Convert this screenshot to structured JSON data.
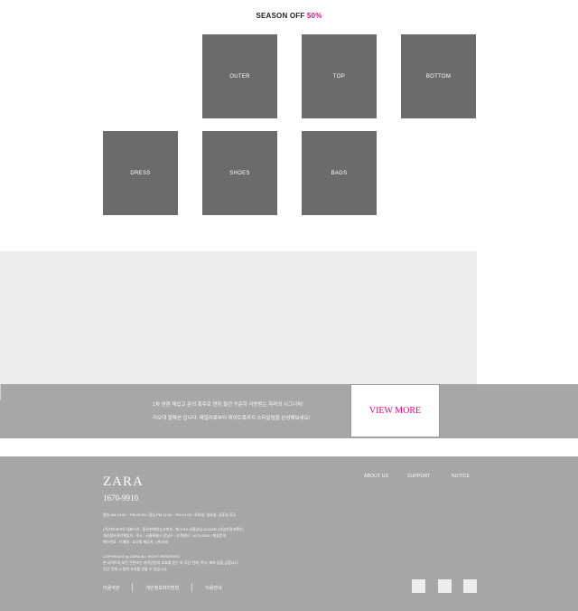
{
  "promo": {
    "title": "SEASON OFF",
    "percent": "50%"
  },
  "categories": [
    "OUTER",
    "TOP",
    "BOTTOM",
    "DRESS",
    "SHOES",
    "BAGS"
  ],
  "banner": {
    "line1": "1차 완판 재입고 문의 폭주로 연장,필간 꾸준히 사랑받는 자라의 시그니처!",
    "line2": "리오대 컬렉션 입니다. 데일리룩부터 데이트룩까지 스타일링을 완성해보세요!",
    "button": "VIEW MORE"
  },
  "footer": {
    "brand": "ZARA",
    "phone": "1670-9910",
    "hours": "평일 AM 10:00 ~ PM 05:00 / 점심 PM 12:00 ~ PM 01:00 / 토요일, 일요일, 공휴일 휴무",
    "info1": "(주)자라코리아 대표이사 : 통신판매업신고번호 : 제 2010-서울강남-01234호 (사업자정보확인)",
    "info2": "개인정보관리책임자 : 주소 : 서울특별시 강남구 / 고객센터 : 1670-9910 / 제휴문의",
    "info3": "팩스번호 : 이메일 : 호스팅 제공자 : (주)자라",
    "copyright": "COPYRIGHT by ZARA ALL RIGHT RESERVED",
    "notice1": "본 사이트의 모든 콘텐츠는 저작권법의 보호를 받는 바 무단 전재, 복사, 배포 등을 금합니다.",
    "notice2": "무단 전재 시 법적 조치를 받을 수 있습니다.",
    "nav": [
      "ABOUT US",
      "SUPPORT",
      "NOTICE"
    ],
    "links": [
      "이용약관",
      "개인정보처리방침",
      "이용안내"
    ]
  }
}
